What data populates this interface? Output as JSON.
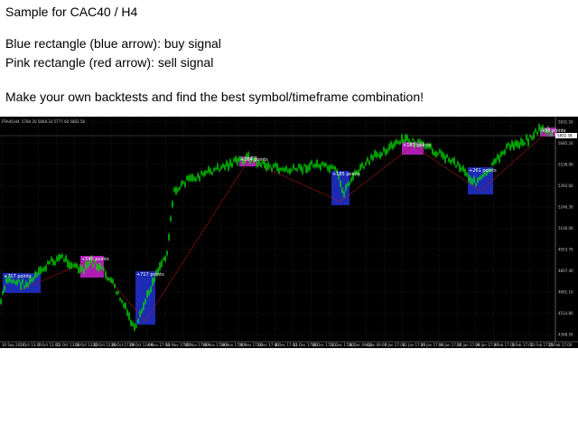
{
  "captions": {
    "title": "Sample for CAC40 / H4",
    "line1": "Blue rectangle (blue arrow): buy signal",
    "line2": "Pink rectangle (red arrow): sell signal",
    "line3": "Make your own backtests and find the best symbol/timeframe combination!"
  },
  "chart": {
    "symbol_label": "FRA40,H4",
    "ohlc_readout": "5784.20 5808.33 5777.60 5802.58",
    "current_price": "5802.58",
    "price_labels": [
      "5831.50",
      "5685.20",
      "5538.90",
      "5392.60",
      "5246.30",
      "5100.00",
      "4953.70",
      "4807.40",
      "4661.10",
      "4514.80",
      "4368.50"
    ],
    "time_labels": [
      "30 Sep 2020",
      "2 Oct 13:00",
      "7 Oct 13:00",
      "13 Oct 13:00",
      "16 Oct 13:00",
      "22 Oct 13:00",
      "26 Oct 17:00",
      "29 Oct 13:00",
      "4 Nov 17:00",
      "10 Nov 17:00",
      "16 Nov 17:00",
      "19 Nov 17:00",
      "24 Nov 17:00",
      "30 Nov 17:00",
      "3 Dec 17:00",
      "8 Dec 17:00",
      "11 Dec 17:00",
      "16 Dec 17:00",
      "21 Dec 17:00",
      "28 Dec 09:00",
      "4 Jan 09:00",
      "7 Jan 17:00",
      "12 Jan 17:00",
      "15 Jan 17:00",
      "20 Jan 17:00",
      "25 Jan 17:00",
      "28 Jan 17:00",
      "2 Feb 17:00",
      "5 Feb 17:00",
      "10 Feb 17:00",
      "15 Feb 17:00"
    ],
    "colors": {
      "background": "#000000",
      "grid": "#2f2f2f",
      "candles": "#00e000",
      "buy_box": "#1f2fc8",
      "sell_box": "#c020c8",
      "trade_line": "#b01818",
      "price_tag": "#ffffff"
    },
    "signals": [
      {
        "type": "buy",
        "label": "+717 points"
      },
      {
        "type": "sell",
        "label": "+540 points"
      },
      {
        "type": "buy",
        "label": "+717 points"
      },
      {
        "type": "sell",
        "label": "+264 points"
      },
      {
        "type": "buy",
        "label": "+185 points"
      },
      {
        "type": "sell",
        "label": "+183 points"
      },
      {
        "type": "buy",
        "label": "+261 points"
      },
      {
        "type": "sell",
        "label": "+98 points"
      }
    ]
  }
}
